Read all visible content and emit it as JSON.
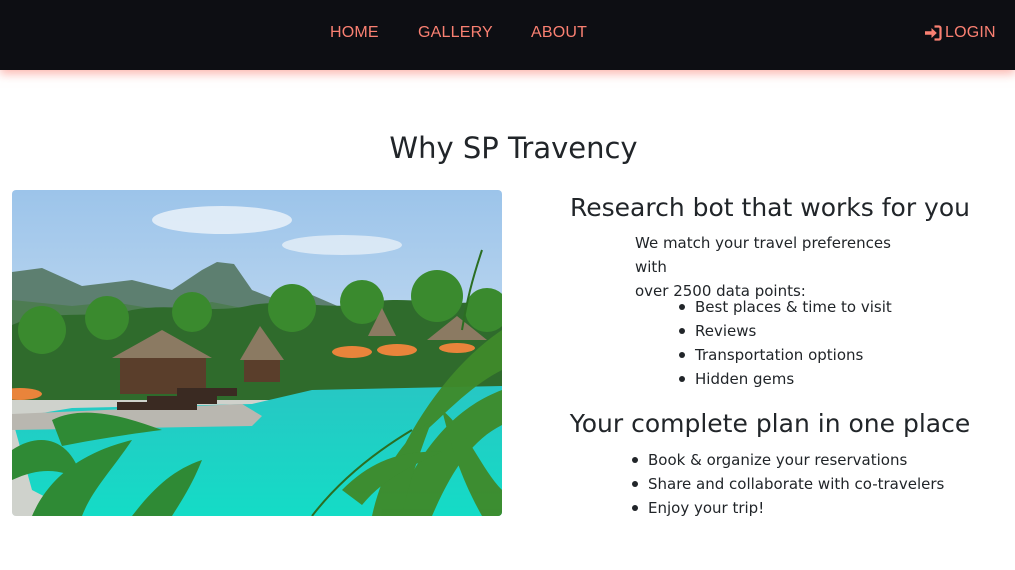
{
  "nav": {
    "home": "HOME",
    "gallery": "GALLERY",
    "about": "ABOUT",
    "login": "LOGIN",
    "login_icon": "sign-in-icon",
    "link_color": "#fa8072",
    "bar_color": "#0d0e13"
  },
  "main": {
    "title": "Why SP Travency",
    "research": {
      "heading": "Research bot that works for you",
      "intro_line1": "We match your travel preferences with",
      "intro_line2": "over 2500 data points:",
      "items": [
        "Best places & time to visit",
        "Reviews",
        "Transportation options",
        "Hidden gems"
      ]
    },
    "plan": {
      "heading": "Your complete plan in one place",
      "items": [
        "Book & organize your reservations",
        "Share and collaborate with co-travelers",
        "Enjoy your trip!"
      ]
    }
  }
}
